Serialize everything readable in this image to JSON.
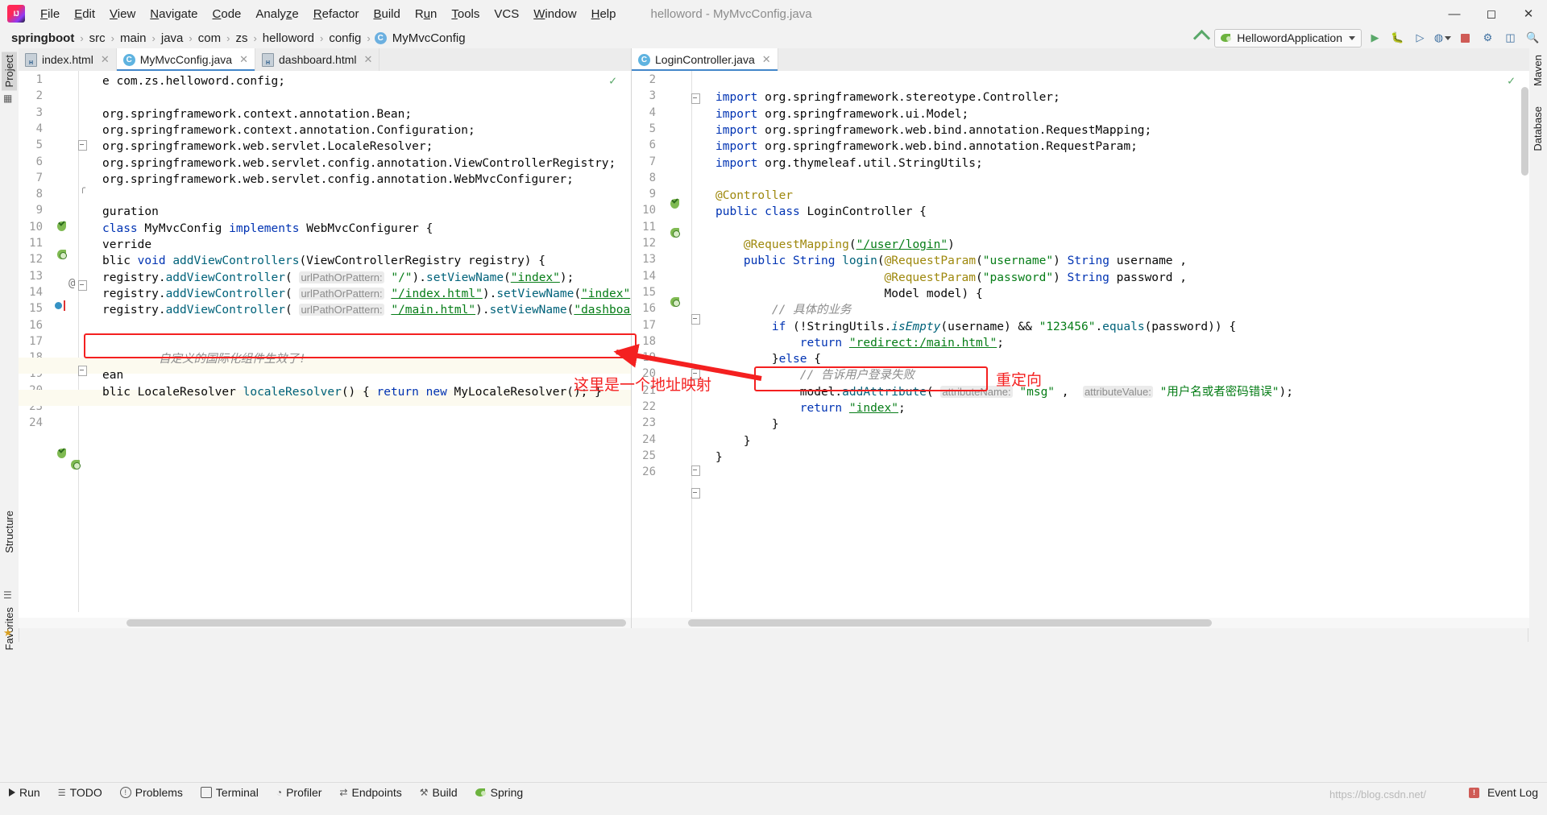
{
  "window": {
    "title": "helloword - MyMvcConfig.java",
    "logo_icon": "intellij-idea-logo",
    "minimize_icon": "minimize-icon",
    "maximize_icon": "maximize-icon",
    "close_icon": "close-icon"
  },
  "menu": [
    {
      "label": "File",
      "mnemonic": "F"
    },
    {
      "label": "Edit",
      "mnemonic": "E"
    },
    {
      "label": "View",
      "mnemonic": "V"
    },
    {
      "label": "Navigate",
      "mnemonic": "N"
    },
    {
      "label": "Code",
      "mnemonic": "C"
    },
    {
      "label": "Analyze",
      "mnemonic": "z"
    },
    {
      "label": "Refactor",
      "mnemonic": "R"
    },
    {
      "label": "Build",
      "mnemonic": "B"
    },
    {
      "label": "Run",
      "mnemonic": "u"
    },
    {
      "label": "Tools",
      "mnemonic": "T"
    },
    {
      "label": "VCS",
      "mnemonic": ""
    },
    {
      "label": "Window",
      "mnemonic": "W"
    },
    {
      "label": "Help",
      "mnemonic": "H"
    }
  ],
  "breadcrumbs": [
    {
      "label": "springboot",
      "bold": true,
      "icon": ""
    },
    {
      "label": "src",
      "bold": false,
      "icon": ""
    },
    {
      "label": "main",
      "bold": false,
      "icon": ""
    },
    {
      "label": "java",
      "bold": false,
      "icon": ""
    },
    {
      "label": "com",
      "bold": false,
      "icon": ""
    },
    {
      "label": "zs",
      "bold": false,
      "icon": ""
    },
    {
      "label": "helloword",
      "bold": false,
      "icon": ""
    },
    {
      "label": "config",
      "bold": false,
      "icon": ""
    },
    {
      "label": "MyMvcConfig",
      "bold": false,
      "icon": "class-icon"
    }
  ],
  "toolbar": {
    "build_icon": "build-hammer-icon",
    "run_config": "HellowordApplication",
    "run_config_caret": "chevron-down-icon",
    "icons": [
      "run-icon",
      "debug-icon",
      "run-with-coverage-icon",
      "profiler-icon",
      "stop-icon",
      "update-running-app-icon",
      "layout-icon",
      "search-everywhere-icon"
    ]
  },
  "left_tool_strip": [
    {
      "label": "Project",
      "selected": true
    },
    {
      "label": "Structure",
      "selected": false
    },
    {
      "label": "Favorites",
      "selected": false
    }
  ],
  "right_tool_strip": [
    {
      "label": "Maven",
      "selected": false
    },
    {
      "label": "Database",
      "selected": false
    }
  ],
  "left_tabs": [
    {
      "label": "index.html",
      "icon": "html-file-icon",
      "active": false
    },
    {
      "label": "MyMvcConfig.java",
      "icon": "java-class-icon",
      "active": true
    },
    {
      "label": "dashboard.html",
      "icon": "html-file-icon",
      "active": false
    }
  ],
  "right_tabs": [
    {
      "label": "LoginController.java",
      "icon": "java-class-icon",
      "active": true
    }
  ],
  "left_editor": {
    "inspection_status": "ok-checkmark",
    "lines": [
      {
        "num": "1",
        "text": "e com.zs.helloword.config;"
      },
      {
        "num": "2",
        "text": ""
      },
      {
        "num": "3",
        "text": "org.springframework.context.annotation.Bean;"
      },
      {
        "num": "4",
        "text": "org.springframework.context.annotation.Configuration;"
      },
      {
        "num": "5",
        "text": "org.springframework.web.servlet.LocaleResolver;"
      },
      {
        "num": "6",
        "text": "org.springframework.web.servlet.config.annotation.ViewControllerRegistry;"
      },
      {
        "num": "7",
        "text": "org.springframework.web.servlet.config.annotation.WebMvcConfigurer;"
      },
      {
        "num": "8",
        "text": ""
      },
      {
        "num": "9",
        "text": "guration"
      },
      {
        "num": "10",
        "text": "class MyMvcConfig implements WebMvcConfigurer {"
      },
      {
        "num": "11",
        "text": "verride"
      },
      {
        "num": "12",
        "text": "blic void addViewControllers(ViewControllerRegistry registry) {"
      },
      {
        "num": "13",
        "text": "registry.addViewController( urlPathOrPattern: \"/\").setViewName(\"index\");"
      },
      {
        "num": "14",
        "text": "registry.addViewController( urlPathOrPattern: \"/index.html\").setViewName(\"index\");"
      },
      {
        "num": "15",
        "text": "registry.addViewController( urlPathOrPattern: \"/main.html\").setViewName(\"dashboard\");"
      },
      {
        "num": "16",
        "text": ""
      },
      {
        "num": "17",
        "text": ""
      },
      {
        "num": "18",
        "text": "自定义的国际化组件生效了!"
      },
      {
        "num": "19",
        "text": "ean"
      },
      {
        "num": "20",
        "text": "blic LocaleResolver localeResolver() { return new MyLocaleResolver(); }"
      },
      {
        "num": "23",
        "text": ""
      },
      {
        "num": "24",
        "text": ""
      }
    ]
  },
  "right_editor": {
    "inspection_status": "ok-checkmark",
    "lines": [
      {
        "num": "2",
        "text": ""
      },
      {
        "num": "3",
        "text": "import org.springframework.stereotype.Controller;"
      },
      {
        "num": "4",
        "text": "import org.springframework.ui.Model;"
      },
      {
        "num": "5",
        "text": "import org.springframework.web.bind.annotation.RequestMapping;"
      },
      {
        "num": "6",
        "text": "import org.springframework.web.bind.annotation.RequestParam;"
      },
      {
        "num": "7",
        "text": "import org.thymeleaf.util.StringUtils;"
      },
      {
        "num": "8",
        "text": ""
      },
      {
        "num": "9",
        "text": "@Controller"
      },
      {
        "num": "10",
        "text": "public class LoginController {"
      },
      {
        "num": "11",
        "text": ""
      },
      {
        "num": "12",
        "text": "    @RequestMapping(\"/user/login\")"
      },
      {
        "num": "13",
        "text": "    public String login(@RequestParam(\"username\") String username ,"
      },
      {
        "num": "14",
        "text": "                        @RequestParam(\"password\") String password ,"
      },
      {
        "num": "15",
        "text": "                        Model model) {"
      },
      {
        "num": "16",
        "text": "        // 具体的业务"
      },
      {
        "num": "17",
        "text": "        if (!StringUtils.isEmpty(username) && \"123456\".equals(password)) {"
      },
      {
        "num": "18",
        "text": "            return \"redirect:/main.html\";"
      },
      {
        "num": "19",
        "text": "        }else {"
      },
      {
        "num": "20",
        "text": "            // 告诉用户登录失败"
      },
      {
        "num": "21",
        "text": "            model.addAttribute( attributeName: \"msg\" ,  attributeValue: \"用户名或者密码错误\");"
      },
      {
        "num": "22",
        "text": "            return \"index\";"
      },
      {
        "num": "23",
        "text": "        }"
      },
      {
        "num": "24",
        "text": "    }"
      },
      {
        "num": "25",
        "text": "}"
      },
      {
        "num": "26",
        "text": ""
      }
    ]
  },
  "annotations": {
    "color": "#f42020",
    "note_left": "这里是一个地址映射",
    "note_right": "重定向",
    "boxed_left_code": "registry.addViewController( urlPathOrPattern: \"/main.html\").setViewName(\"dashboard\");",
    "boxed_right_code": "return \"redirect:/main.html\";",
    "arrow_icon": "red-arrow-icon"
  },
  "status_bar": {
    "items": [
      {
        "label": "Run",
        "icon": "run-icon"
      },
      {
        "label": "TODO",
        "icon": "todo-icon"
      },
      {
        "label": "Problems",
        "icon": "problems-icon"
      },
      {
        "label": "Terminal",
        "icon": "terminal-icon"
      },
      {
        "label": "Profiler",
        "icon": "profiler-icon"
      },
      {
        "label": "Endpoints",
        "icon": "endpoints-icon"
      },
      {
        "label": "Build",
        "icon": "build-icon"
      },
      {
        "label": "Spring",
        "icon": "spring-leaf-icon"
      }
    ],
    "event_log": "Event Log",
    "event_log_icon": "event-log-icon",
    "watermark": "https://blog.csdn.net/"
  }
}
